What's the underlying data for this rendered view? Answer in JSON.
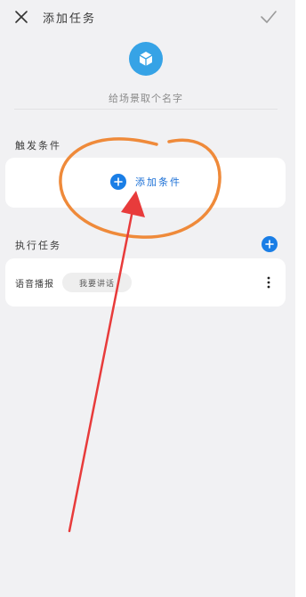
{
  "header": {
    "title": "添加任务",
    "close_icon": "close-icon",
    "confirm_icon": "checkmark-icon"
  },
  "scene": {
    "icon": "cube-icon",
    "icon_color": "#36a3e6",
    "name_placeholder": "给场景取个名字"
  },
  "trigger": {
    "section_label": "触发条件",
    "add_label": "添加条件",
    "add_icon": "plus-circle-icon",
    "accent_color": "#1a7ee6"
  },
  "tasks": {
    "section_label": "执行任务",
    "add_icon": "plus-circle-icon",
    "items": [
      {
        "name": "语音播报",
        "chip": "我要讲话",
        "more_icon": "more-vertical-icon"
      }
    ]
  },
  "annotation": {
    "circle_color": "#ef8a3a",
    "arrow_color": "#e83b3b"
  }
}
